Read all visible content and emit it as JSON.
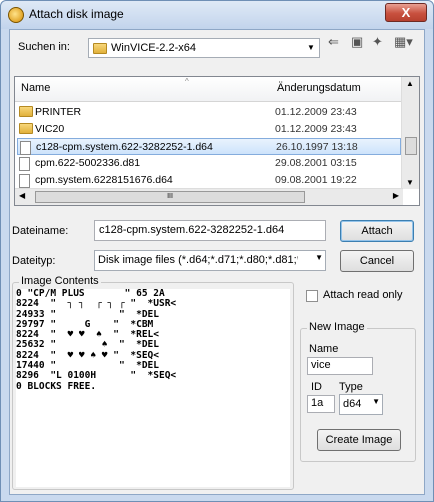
{
  "window": {
    "title": "Attach disk image",
    "close_label": "X"
  },
  "lookin": {
    "label": "Suchen in:",
    "value": "WinVICE-2.2-x64"
  },
  "columns": {
    "name": "Name",
    "date": "Änderungsdatum"
  },
  "files": [
    {
      "name": "PRINTER",
      "date": "01.12.2009 23:43",
      "type": "folder"
    },
    {
      "name": "VIC20",
      "date": "01.12.2009 23:43",
      "type": "folder"
    },
    {
      "name": "c128-cpm.system.622-3282252-1.d64",
      "date": "26.10.1997 13:18",
      "type": "file"
    },
    {
      "name": "cpm.622-5002336.d81",
      "date": "29.08.2001 03:15",
      "type": "file"
    },
    {
      "name": "cpm.system.6228151676.d64",
      "date": "09.08.2001 19:22",
      "type": "file"
    }
  ],
  "hscroll_thumb": "III",
  "filename": {
    "label": "Dateiname:",
    "value": "c128-cpm.system.622-3282252-1.d64"
  },
  "filetype": {
    "label": "Dateityp:",
    "value": "Disk image files (*.d64;*.d71;*.d80;*.d81;*.d8"
  },
  "buttons": {
    "attach": "Attach",
    "cancel": "Cancel",
    "create_image": "Create Image"
  },
  "contents": {
    "group_label": "Image Contents",
    "lines": [
      "0 \"CP/M PLUS       \" 65 2A",
      "8224  \"  ┐ ┐  ┌ ┐ ┌ \"  *USR<",
      "24933 \"           \"  *DEL",
      "29797 \"     G    \"  *CBM",
      "8224  \"  ♥ ♥  ♠  \"  *REL<",
      "25632 \"        ♠  \"  *DEL",
      "8224  \"  ♥ ♥ ♠ ♥ \"  *SEQ<",
      "17440 \"           \"  *DEL",
      "8296  \"L 0100H      \"  *SEQ<",
      "0 BLOCKS FREE."
    ]
  },
  "attach_readonly": {
    "label": "Attach read only",
    "checked": false
  },
  "new_image": {
    "group_label": "New Image",
    "name_label": "Name",
    "name_value": "vice",
    "id_label": "ID",
    "id_value": "1a",
    "type_label": "Type",
    "type_value": "d64"
  }
}
